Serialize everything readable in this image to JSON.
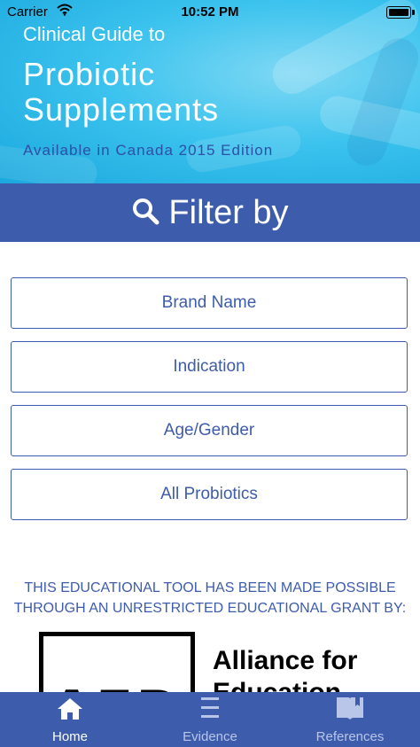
{
  "status_bar": {
    "carrier": "Carrier",
    "time": "10:52 PM"
  },
  "header": {
    "title_small": "Clinical Guide to",
    "title_large": "Probiotic Supplements",
    "subtitle": "Available in Canada 2015 Edition"
  },
  "filter": {
    "title": "Filter by",
    "buttons": [
      {
        "label": "Brand Name"
      },
      {
        "label": "Indication"
      },
      {
        "label": "Age/Gender"
      },
      {
        "label": "All Probiotics"
      }
    ]
  },
  "grant": {
    "line1": "THIS EDUCATIONAL TOOL HAS BEEN MADE POSSIBLE",
    "line2": "THROUGH AN UNRESTRICTED EDUCATIONAL GRANT BY:"
  },
  "logo": {
    "letters": "AEP",
    "line1": "Alliance for",
    "line2": "Education"
  },
  "tabs": [
    {
      "label": "Home",
      "icon": "home-icon",
      "active": true
    },
    {
      "label": "Evidence",
      "icon": "menu-icon",
      "active": false
    },
    {
      "label": "References",
      "icon": "book-icon",
      "active": false
    }
  ],
  "colors": {
    "brand_blue": "#3d5cab",
    "header_cyan": "#3cc3ee",
    "inactive_tab": "#b9c6ea"
  }
}
